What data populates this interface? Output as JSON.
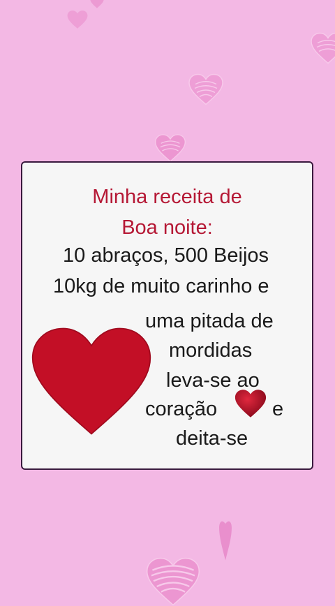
{
  "recipe": {
    "title_line1": "Minha receita de",
    "title_line2": "Boa noite:",
    "line1": "10 abraços, 500 Beijos",
    "line2": "10kg de muito carinho e",
    "line3": "uma pitada de",
    "line4": "mordidas",
    "line5": "leva-se ao",
    "line6a": "coração",
    "line6b": "e",
    "line7": "deita-se"
  },
  "colors": {
    "background": "#f3b8e4",
    "title": "#b51835",
    "heart": "#c30f26",
    "card": "#f6f6f6"
  }
}
